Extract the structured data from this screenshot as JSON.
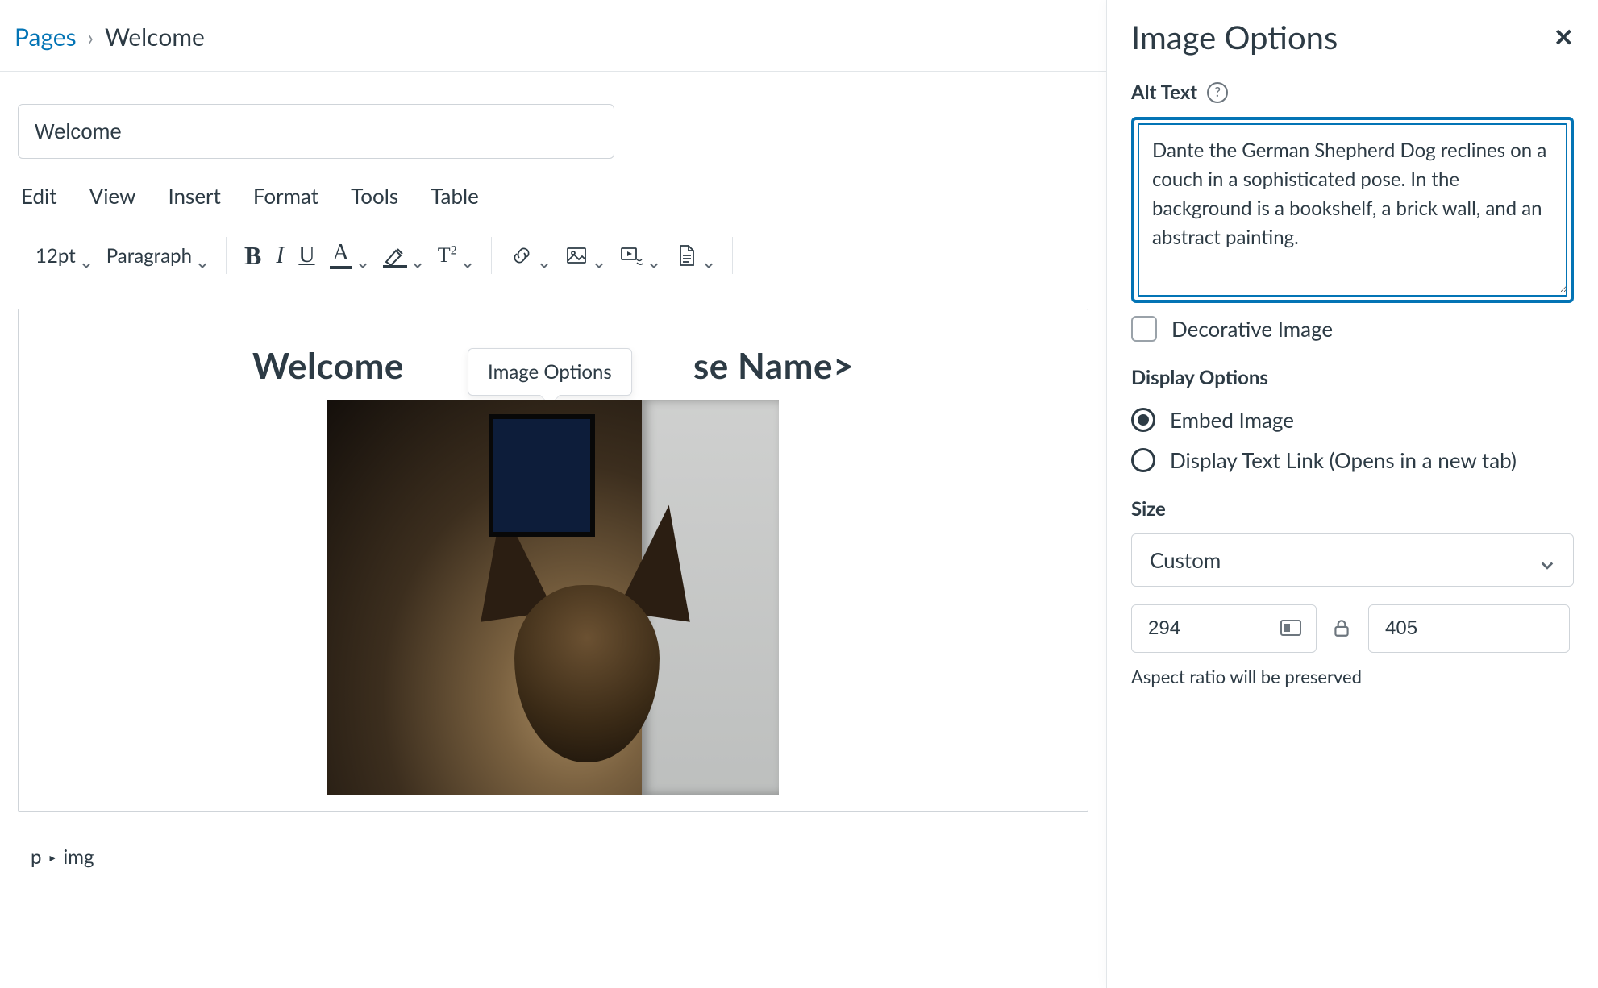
{
  "breadcrumb": {
    "root": "Pages",
    "current": "Welcome"
  },
  "title_input": {
    "value": "Welcome"
  },
  "menubar": {
    "edit": "Edit",
    "view": "View",
    "insert": "Insert",
    "format": "Format",
    "tools": "Tools",
    "table": "Table"
  },
  "toolbar": {
    "font_size": "12pt",
    "block_format": "Paragraph",
    "bold": "B",
    "italic": "I",
    "underline": "U",
    "text_color": "A",
    "superscript": "T",
    "superscript_exp": "2"
  },
  "editor_content": {
    "heading_prefix": "Welcome",
    "heading_suffix": "se Name>",
    "tooltip": "Image Options"
  },
  "status_path": {
    "a": "p",
    "b": "img"
  },
  "sidebar": {
    "title": "Image Options",
    "alt_text": {
      "label": "Alt Text",
      "value": "Dante the German Shepherd Dog reclines on a couch in a sophisticated pose. In the background is a bookshelf, a brick wall, and an abstract painting."
    },
    "decorative": {
      "label": "Decorative Image",
      "checked": false
    },
    "display_options": {
      "label": "Display Options",
      "options": [
        "Embed Image",
        "Display Text Link (Opens in a new tab)"
      ],
      "selected_index": 0
    },
    "size": {
      "label": "Size",
      "select_value": "Custom",
      "width": "294",
      "height": "405",
      "note": "Aspect ratio will be preserved"
    }
  }
}
